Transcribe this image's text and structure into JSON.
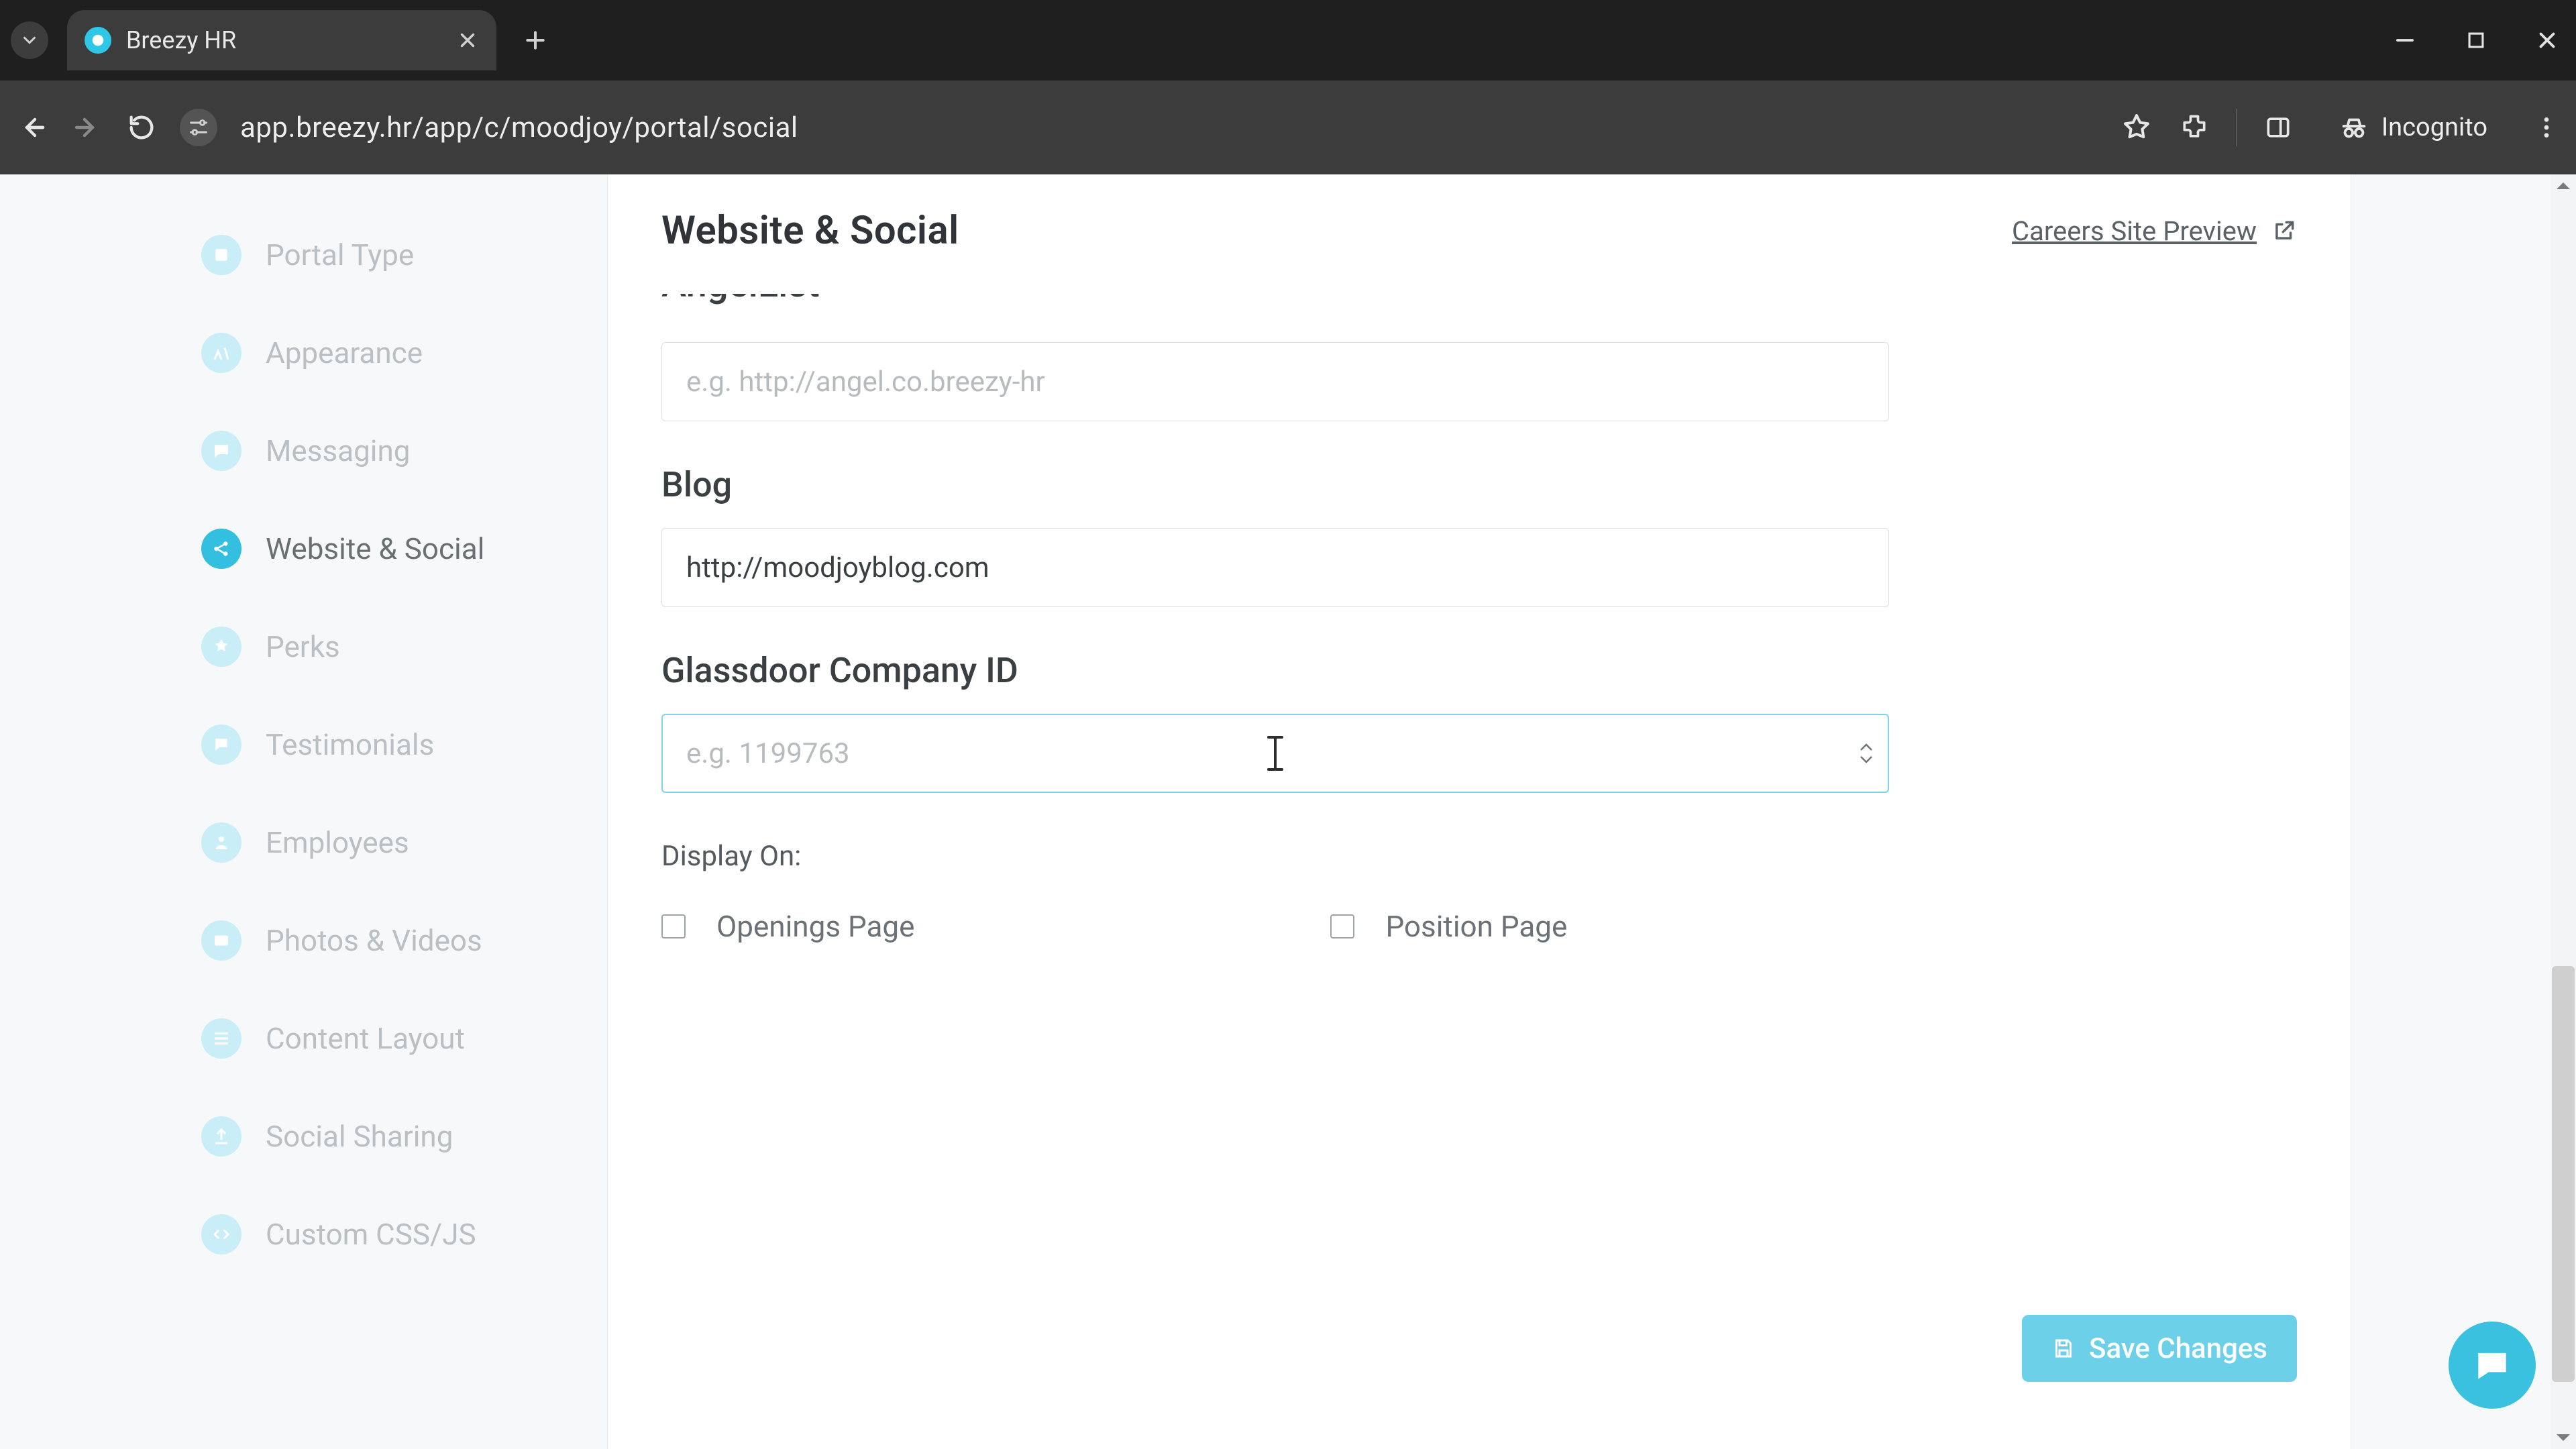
{
  "browser": {
    "tab_title": "Breezy HR",
    "url": "app.breezy.hr/app/c/moodjoy/portal/social",
    "incognito_label": "Incognito"
  },
  "sidebar": {
    "items": [
      {
        "label": "Portal Type",
        "icon": "portal-type-icon",
        "active": false
      },
      {
        "label": "Appearance",
        "icon": "appearance-icon",
        "active": false
      },
      {
        "label": "Messaging",
        "icon": "messaging-icon",
        "active": false
      },
      {
        "label": "Website & Social",
        "icon": "share-icon",
        "active": true
      },
      {
        "label": "Perks",
        "icon": "perks-icon",
        "active": false
      },
      {
        "label": "Testimonials",
        "icon": "testimonials-icon",
        "active": false
      },
      {
        "label": "Employees",
        "icon": "employees-icon",
        "active": false
      },
      {
        "label": "Photos & Videos",
        "icon": "photos-videos-icon",
        "active": false
      },
      {
        "label": "Content Layout",
        "icon": "content-layout-icon",
        "active": false
      },
      {
        "label": "Social Sharing",
        "icon": "social-sharing-icon",
        "active": false
      },
      {
        "label": "Custom CSS/JS",
        "icon": "custom-css-js-icon",
        "active": false
      }
    ]
  },
  "page": {
    "title": "Website & Social",
    "preview_link": "Careers Site Preview",
    "angellist": {
      "heading": "AngelList",
      "placeholder": "e.g. http://angel.co.breezy-hr",
      "value": ""
    },
    "blog": {
      "heading": "Blog",
      "value": "http://moodjoyblog.com"
    },
    "glassdoor": {
      "heading": "Glassdoor Company ID",
      "placeholder": "e.g. 1199763",
      "value": ""
    },
    "display_on": {
      "label": "Display On:",
      "openings": {
        "label": "Openings Page",
        "checked": false
      },
      "position": {
        "label": "Position Page",
        "checked": false
      }
    },
    "save_label": "Save Changes"
  }
}
